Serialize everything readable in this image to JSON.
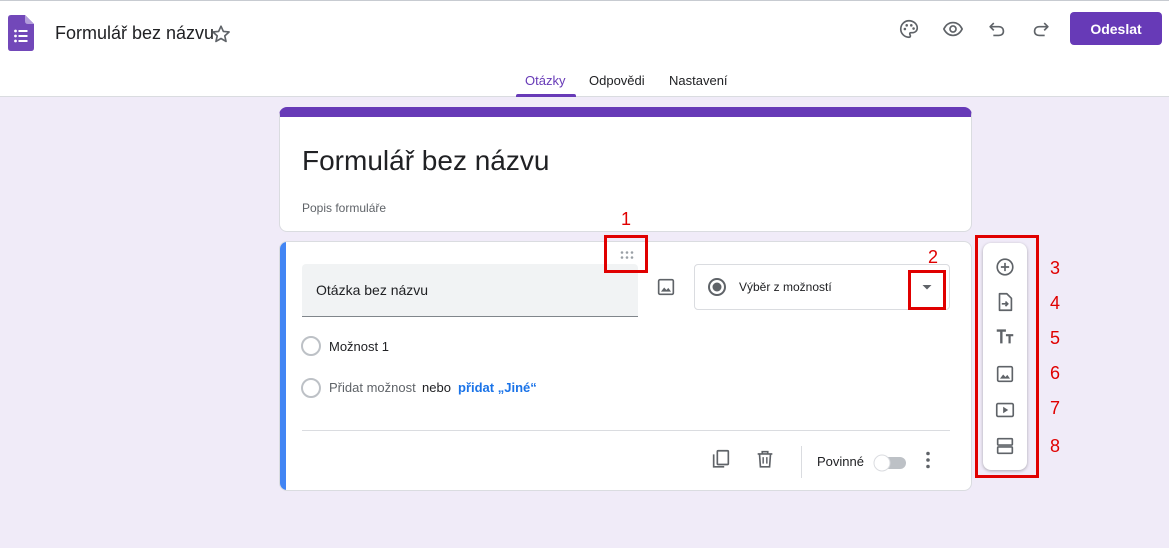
{
  "header": {
    "doc_title": "Formulář bez názvu",
    "send_label": "Odeslat",
    "icons": [
      "palette-icon",
      "preview-eye-icon",
      "undo-icon",
      "redo-icon",
      "star-icon"
    ]
  },
  "tabs": [
    {
      "label": "Otázky",
      "active": true
    },
    {
      "label": "Odpovědi",
      "active": false
    },
    {
      "label": "Nastavení",
      "active": false
    }
  ],
  "form": {
    "title": "Formulář bez názvu",
    "description_placeholder": "Popis formuláře"
  },
  "question": {
    "title": "Otázka bez názvu",
    "type_label": "Výběr z možností",
    "options": [
      "Možnost 1"
    ],
    "add_option": "Přidat možnost",
    "or_text": "nebo",
    "add_other": "přidat „Jiné“",
    "required_label": "Povinné",
    "required": false
  },
  "side_toolbar": [
    "add-question-icon",
    "import-questions-icon",
    "add-title-icon",
    "add-image-icon",
    "add-video-icon",
    "add-section-icon"
  ],
  "annotations": [
    "1",
    "2",
    "3",
    "4",
    "5",
    "6",
    "7",
    "8"
  ],
  "colors": {
    "accent": "#673ab7",
    "background": "#f0ebf8",
    "active_question": "#4285f4",
    "link": "#1a73e8",
    "annotation": "#e00000"
  }
}
